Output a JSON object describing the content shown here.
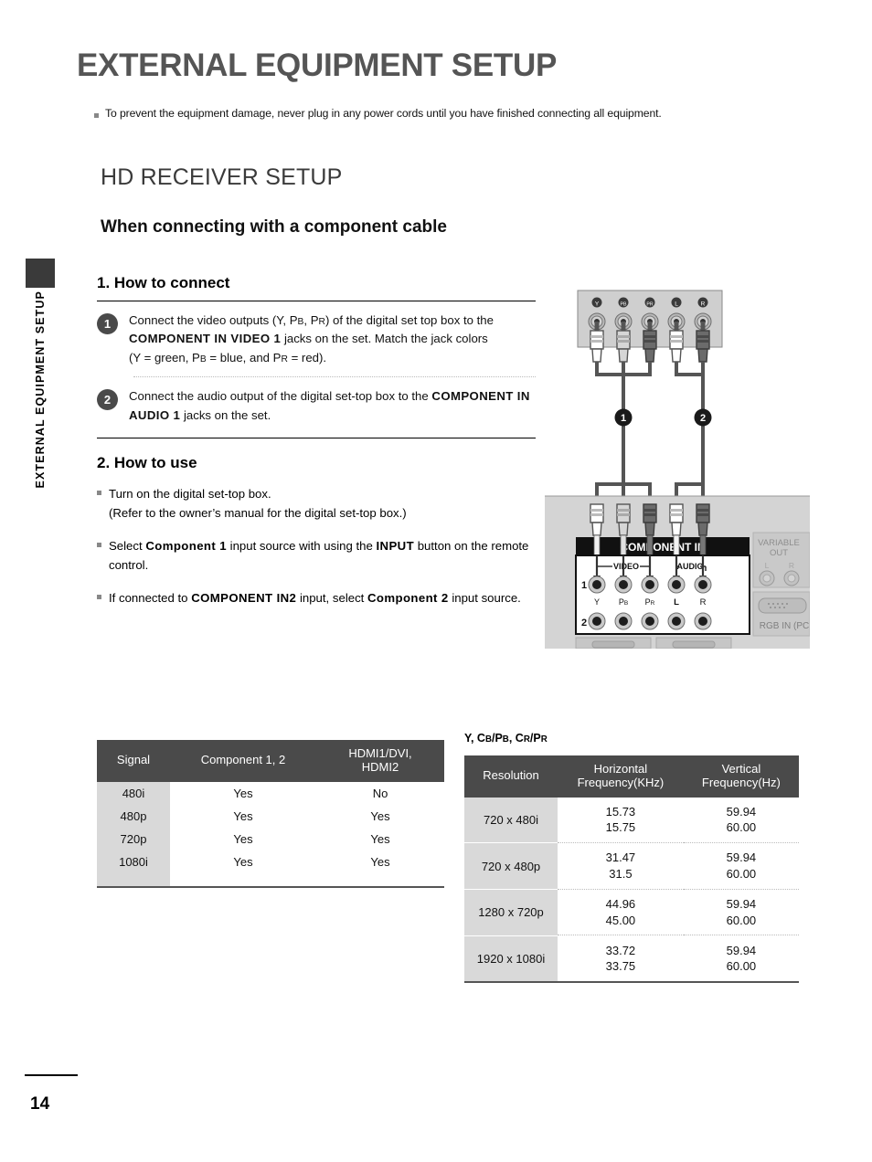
{
  "side_tab": {
    "label": "EXTERNAL EQUIPMENT SETUP"
  },
  "header": {
    "title": "EXTERNAL EQUIPMENT SETUP",
    "warning": "To prevent the equipment damage, never plug in any power cords until you have finished connecting all equipment.",
    "section_title": "HD RECEIVER SETUP",
    "sub_title": "When connecting with a component cable"
  },
  "connect": {
    "heading": "1. How to connect",
    "steps": [
      {
        "number": "1",
        "line1_a": "Connect the video outputs (Y, P",
        "line1_sub1": "B",
        "line1_b": ", P",
        "line1_sub2": "R",
        "line1_c": ") of the digital set top box to the ",
        "bold1": "COMPONENT IN VIDEO 1",
        "line1_d": " jacks on the set. Match the jack colors",
        "line2_a": "(Y = green, P",
        "line2_sub1": "B",
        "line2_b": " = blue, and P",
        "line2_sub2": "R",
        "line2_c": " = red)."
      },
      {
        "number": "2",
        "text_a": "Connect the audio output of the digital set-top box to the ",
        "bold1": "COMPONENT IN AUDIO 1",
        "text_b": " jacks on the set."
      }
    ]
  },
  "use": {
    "heading": "2. How to use",
    "items": [
      {
        "text_a": "Turn on the digital set-top box.",
        "text_b": "(Refer to the owner’s manual for the digital set-top box.)"
      },
      {
        "pre": "Select ",
        "bold1": "Component 1",
        "mid": " input source with using the ",
        "bold2": "INPUT",
        "post": " button on the remote control."
      },
      {
        "pre": "If connected to ",
        "bold1": "COMPONENT IN2",
        "mid": " input, select ",
        "bold2": "Component 2",
        "post": " input source."
      }
    ]
  },
  "diagram": {
    "stb_jack_labels": [
      "Y",
      "PB",
      "PR",
      "L",
      "R"
    ],
    "cable_badges": [
      "1",
      "2"
    ],
    "tv_panel": {
      "title": "COMPONENT IN",
      "video_label": "VIDEO",
      "audio_label": "AUDIO",
      "row_labels": [
        "1",
        "2"
      ],
      "jack_labels": [
        "Y",
        "PB",
        "PR",
        "L",
        "R"
      ],
      "variable_out": "VARIABLE OUT",
      "variable_out_l": "L",
      "variable_out_r": "R",
      "rgb_in": "RGB IN (PC"
    }
  },
  "table_signal": {
    "headers": [
      "Signal",
      "Component 1, 2",
      "HDMI1/DVI, HDMI2"
    ],
    "header_hdmi_line1": "HDMI1/DVI,",
    "header_hdmi_line2": "HDMI2",
    "rows": [
      [
        "480i",
        "Yes",
        "No"
      ],
      [
        "480p",
        "Yes",
        "Yes"
      ],
      [
        "720p",
        "Yes",
        "Yes"
      ],
      [
        "1080i",
        "Yes",
        "Yes"
      ]
    ]
  },
  "table_resolution": {
    "caption_a": "Y, C",
    "caption_sub1": "B",
    "caption_b": "/P",
    "caption_sub2": "B",
    "caption_c": ", C",
    "caption_sub3": "R",
    "caption_d": "/P",
    "caption_sub4": "R",
    "headers": [
      "Resolution",
      "Horizontal Frequency(KHz)",
      "Vertical Frequency(Hz)"
    ],
    "header_h_line1": "Horizontal",
    "header_h_line2": "Frequency(KHz)",
    "header_v_line1": "Vertical",
    "header_v_line2": "Frequency(Hz)",
    "rows": [
      {
        "resolution": "720 x 480i",
        "h1": "15.73",
        "h2": "15.75",
        "v1": "59.94",
        "v2": "60.00"
      },
      {
        "resolution": "720 x 480p",
        "h1": "31.47",
        "h2": "31.5",
        "v1": "59.94",
        "v2": "60.00"
      },
      {
        "resolution": "1280 x 720p",
        "h1": "44.96",
        "h2": "45.00",
        "v1": "59.94",
        "v2": "60.00"
      },
      {
        "resolution": "1920 x 1080i",
        "h1": "33.72",
        "h2": "33.75",
        "v1": "59.94",
        "v2": "60.00"
      }
    ]
  },
  "footer": {
    "page_number": "14"
  },
  "colors": {
    "header_gray": "#4a4a4a",
    "cell_gray": "#d9d9d9",
    "title_gray": "#555555"
  }
}
